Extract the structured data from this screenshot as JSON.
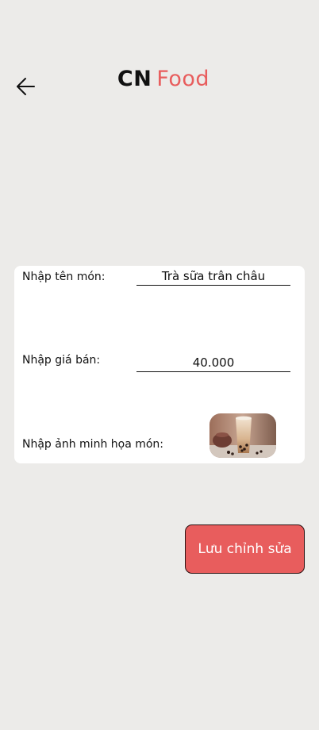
{
  "header": {
    "brand_part1": "CN",
    "brand_part2": "Food",
    "back_icon": "arrow-left-icon",
    "brand_accent_color": "#e85d5d"
  },
  "form": {
    "name_label": "Nhập tên món:",
    "name_value": "Trà sữa trân châu",
    "price_label": "Nhập giá bán:",
    "price_value": "40.000",
    "image_label": "Nhập ảnh minh họa món:"
  },
  "actions": {
    "save_label": "Lưu chỉnh sửa",
    "save_color": "#e85d5d"
  }
}
